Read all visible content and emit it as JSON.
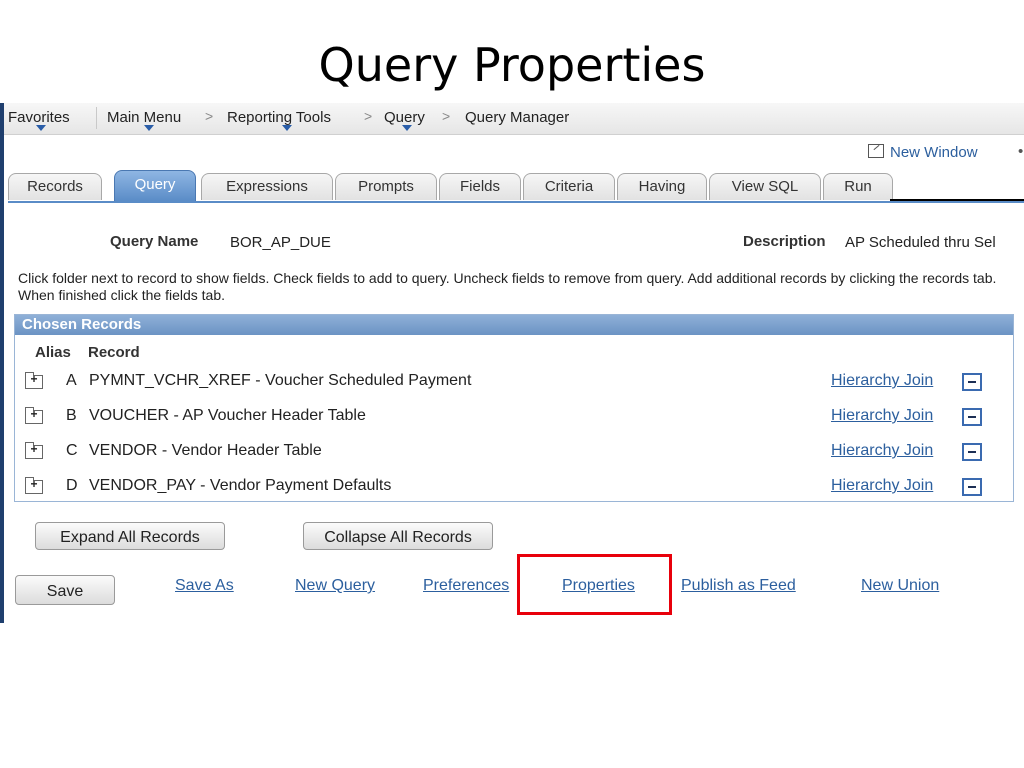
{
  "slide": {
    "title": "Query Properties"
  },
  "nav": {
    "favorites": "Favorites",
    "main_menu": "Main Menu",
    "sep": ">",
    "reporting_tools": "Reporting Tools",
    "query": "Query",
    "query_manager": "Query Manager"
  },
  "new_window": "New Window",
  "tabs": [
    "Records",
    "Query",
    "Expressions",
    "Prompts",
    "Fields",
    "Criteria",
    "Having",
    "View SQL",
    "Run"
  ],
  "active_tab": "Query",
  "query": {
    "name_label": "Query Name",
    "name_value": "BOR_AP_DUE",
    "desc_label": "Description",
    "desc_value": "AP Scheduled thru Sel"
  },
  "instructions": "Click folder next to record to show fields. Check fields to add to query. Uncheck fields to remove from query. Add additional records by clicking the records tab. When finished click the fields tab.",
  "grid": {
    "title": "Chosen Records",
    "col_alias": "Alias",
    "col_record": "Record",
    "rows": [
      {
        "alias": "A",
        "record": "PYMNT_VCHR_XREF - Voucher Scheduled Payment",
        "join": "Hierarchy Join"
      },
      {
        "alias": "B",
        "record": "VOUCHER - AP Voucher Header Table",
        "join": "Hierarchy Join"
      },
      {
        "alias": "C",
        "record": "VENDOR - Vendor Header Table",
        "join": "Hierarchy Join"
      },
      {
        "alias": "D",
        "record": "VENDOR_PAY - Vendor Payment Defaults",
        "join": "Hierarchy Join"
      }
    ]
  },
  "buttons": {
    "expand_all": "Expand All Records",
    "collapse_all": "Collapse All Records",
    "save": "Save"
  },
  "links": {
    "save_as": "Save As",
    "new_query": "New Query",
    "preferences": "Preferences",
    "properties": "Properties",
    "publish_as_feed": "Publish as Feed",
    "new_union": "New Union"
  },
  "colors": {
    "highlight": "#e8000b",
    "link": "#2c5f9e",
    "active_tab": "#5a8cc7",
    "grid_header": "#6b93c4"
  }
}
